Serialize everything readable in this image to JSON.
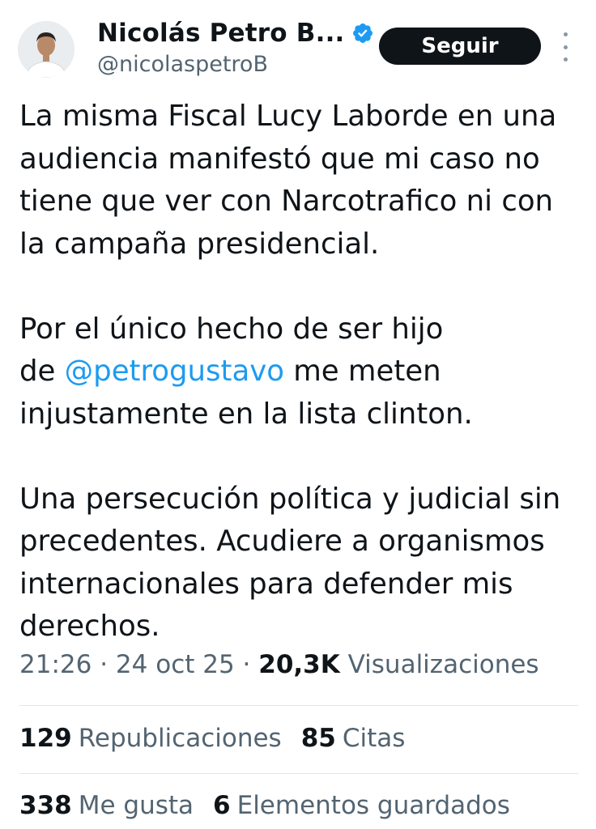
{
  "author": {
    "display_name": "Nicolás Petro B...",
    "handle": "@nicolaspetroB",
    "verified_icon": "verified-badge-icon",
    "avatar_icon": "avatar-photo"
  },
  "follow_button": {
    "label": "Seguir"
  },
  "more_button": {
    "icon": "more-vertical-icon"
  },
  "tweet": {
    "paragraph1": "La misma Fiscal Lucy Laborde en una audiencia manifestó que mi caso no tiene que ver con Narcotrafico ni con la campaña presidencial.",
    "paragraph2_before": "Por el único hecho de ser hijo\nde ",
    "mention": "@petrogustavo",
    "paragraph2_after": " me meten injustamente en la lista clinton.",
    "paragraph3": "Una persecución política y judicial sin precedentes. Acudiere a organismos internacionales para defender mis derechos."
  },
  "meta": {
    "time": "21:26",
    "date": "24 oct 25",
    "views_count": "20,3K",
    "views_label": "Visualizaciones",
    "separator": "·"
  },
  "stats": {
    "reposts_count": "129",
    "reposts_label": "Republicaciones",
    "quotes_count": "85",
    "quotes_label": "Citas",
    "likes_count": "338",
    "likes_label": "Me gusta",
    "bookmarks_count": "6",
    "bookmarks_label": "Elementos guardados"
  },
  "colors": {
    "accent": "#1d9bf0",
    "text": "#0f1419",
    "secondary": "#536471"
  }
}
